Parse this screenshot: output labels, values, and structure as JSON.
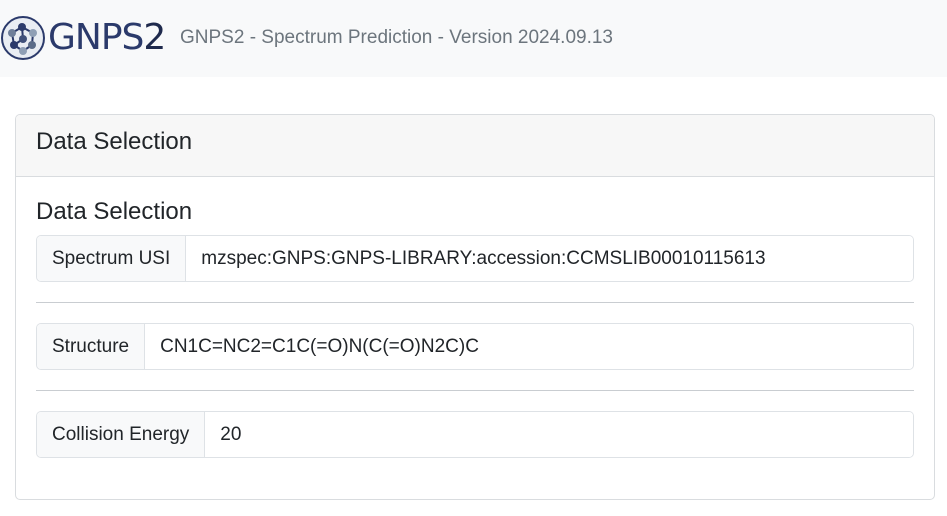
{
  "navbar": {
    "logo_text_main": "GNPS",
    "logo_text_num": "2",
    "title": "GNPS2 - Spectrum Prediction - Version 2024.09.13"
  },
  "card": {
    "header_title": "Data Selection",
    "section_title": "Data Selection",
    "fields": [
      {
        "label": "Spectrum USI",
        "value": "mzspec:GNPS:GNPS-LIBRARY:accession:CCMSLIB00010115613"
      },
      {
        "label": "Structure",
        "value": "CN1C=NC2=C1C(=O)N(C(=O)N2C)C"
      },
      {
        "label": "Collision Energy",
        "value": "20"
      }
    ]
  },
  "colors": {
    "navbar_bg": "#f8f9fa",
    "logo_blue": "#2b3a6b",
    "muted_text": "#6c757d"
  }
}
